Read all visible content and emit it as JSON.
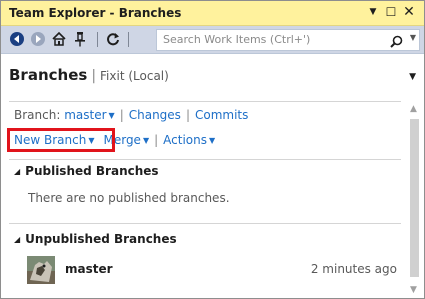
{
  "window": {
    "title": "Team Explorer - Branches",
    "dropdown_icon": "chevron-down-icon",
    "maximize_icon": "maximize-icon",
    "close_icon": "close-icon"
  },
  "toolbar": {
    "search_placeholder": "Search Work Items (Ctrl+')",
    "icons": [
      "back-icon",
      "forward-icon",
      "home-icon",
      "pin-icon",
      "refresh-icon",
      "search-icon"
    ]
  },
  "header": {
    "title": "Branches",
    "separator": "|",
    "repo": "Fixit (Local)"
  },
  "branch_bar": {
    "label": "Branch:",
    "current": "master",
    "changes": "Changes",
    "commits": "Commits",
    "separator": "|"
  },
  "actions": {
    "new_branch": "New Branch",
    "merge": "Merge",
    "actions": "Actions"
  },
  "published": {
    "title": "Published Branches",
    "empty": "There are no published branches."
  },
  "unpublished": {
    "title": "Unpublished Branches",
    "branches": [
      {
        "name": "master",
        "time": "2 minutes ago"
      }
    ]
  },
  "colors": {
    "title_bar": "#fff29d",
    "toolbar": "#cfd6e5",
    "link": "#1e6fc7",
    "highlight": "#e1141c"
  }
}
